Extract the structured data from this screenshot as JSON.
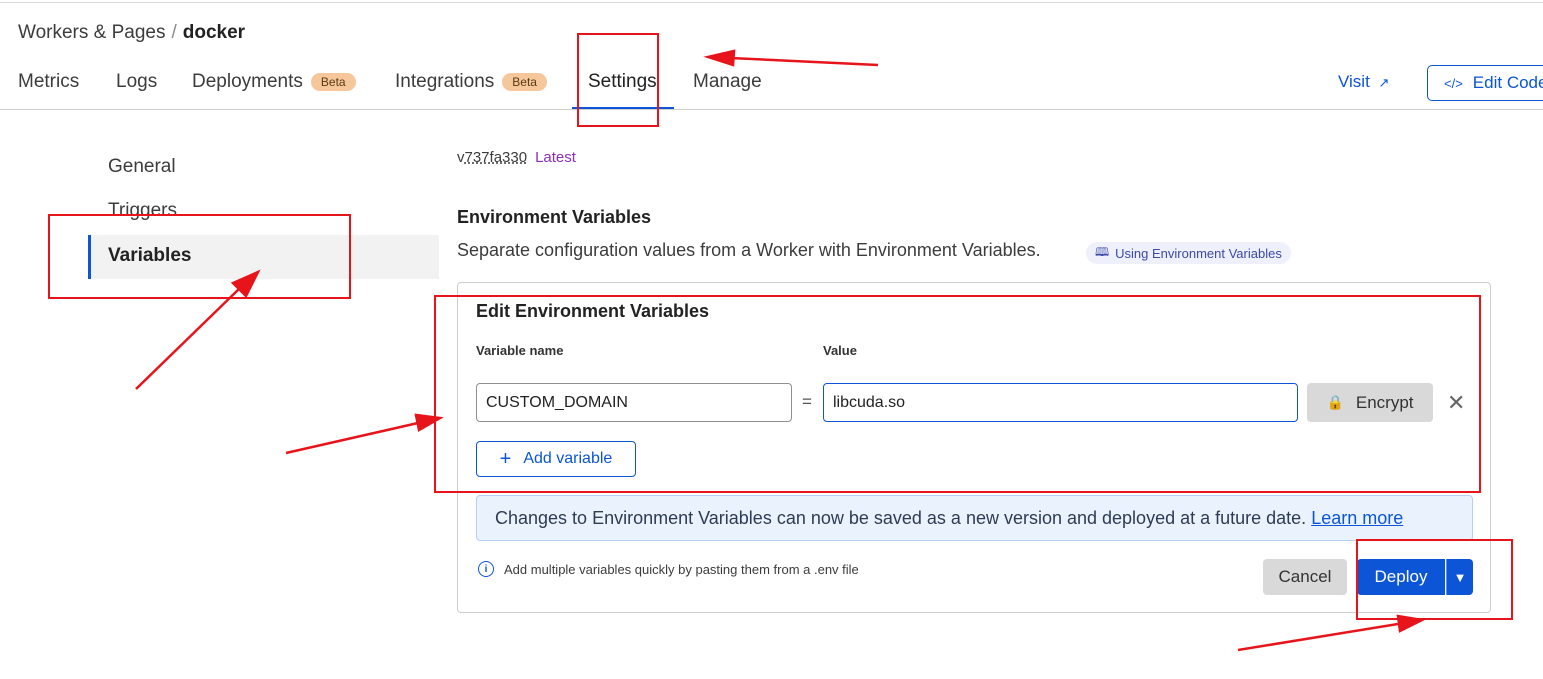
{
  "breadcrumb": {
    "parent": "Workers & Pages",
    "separator": "/",
    "current": "docker"
  },
  "tabs": [
    {
      "label": "Metrics"
    },
    {
      "label": "Logs"
    },
    {
      "label": "Deployments",
      "badge": "Beta"
    },
    {
      "label": "Integrations",
      "badge": "Beta"
    },
    {
      "label": "Settings",
      "active": true
    },
    {
      "label": "Manage"
    }
  ],
  "header_actions": {
    "visit_label": "Visit",
    "edit_code_label": "Edit Code"
  },
  "sidebar": {
    "items": [
      {
        "label": "General"
      },
      {
        "label": "Triggers"
      },
      {
        "label": "Variables",
        "active": true
      }
    ]
  },
  "version": {
    "prefix": "v",
    "hash": "737fa330",
    "tag": "Latest"
  },
  "env_section": {
    "title": "Environment Variables",
    "description": "Separate configuration values from a Worker with Environment Variables.",
    "doc_link": "Using Environment Variables"
  },
  "editor": {
    "title": "Edit Environment Variables",
    "name_header": "Variable name",
    "value_header": "Value",
    "rows": [
      {
        "name": "CUSTOM_DOMAIN",
        "equals": "=",
        "value": "libcuda.so",
        "encrypt_label": "Encrypt"
      }
    ],
    "add_label": "Add variable"
  },
  "notice": {
    "text": "Changes to Environment Variables can now be saved as a new version and deployed at a future date.",
    "link": "Learn more"
  },
  "hint": "Add multiple variables quickly by pasting them from a .env file",
  "footer_actions": {
    "cancel_label": "Cancel",
    "deploy_label": "Deploy"
  },
  "colors": {
    "accent": "#0b55d6",
    "annotation_red": "#e8141b",
    "badge_bg": "#f6c79b",
    "latest": "#8a2fbf"
  }
}
